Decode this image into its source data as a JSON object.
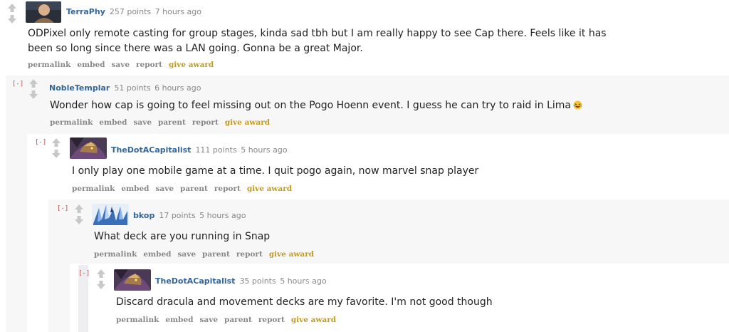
{
  "comments": [
    {
      "author": "TerraPhy",
      "points": "257 points",
      "time": "7 hours ago",
      "body": "ODPixel only remote casting for group stages, kinda sad tbh but I am really happy to see Cap there. Feels like it has been so long since there was a LAN going. Gonna be a great Major.",
      "buttons": [
        "permalink",
        "embed",
        "save",
        "report",
        "give award"
      ]
    },
    {
      "collapse": "[-]",
      "author": "NobleTemplar",
      "points": "51 points",
      "time": "6 hours ago",
      "body": "Wonder how cap is going to feel missing out on the Pogo Hoenn event. I guess he can try to raid in Lima",
      "emoji": "laughing-emoji",
      "buttons": [
        "permalink",
        "embed",
        "save",
        "parent",
        "report",
        "give award"
      ]
    },
    {
      "collapse": "[-]",
      "author": "TheDotACapitalist",
      "points": "111 points",
      "time": "5 hours ago",
      "body": "I only play one mobile game at a time. I quit pogo again, now marvel snap player",
      "buttons": [
        "permalink",
        "embed",
        "save",
        "parent",
        "report",
        "give award"
      ]
    },
    {
      "collapse": "[-]",
      "author": "bkop",
      "points": "17 points",
      "time": "5 hours ago",
      "body": "What deck are you running in Snap",
      "buttons": [
        "permalink",
        "embed",
        "save",
        "parent",
        "report",
        "give award"
      ]
    },
    {
      "collapse": "[-]",
      "author": "TheDotACapitalist",
      "points": "35 points",
      "time": "5 hours ago",
      "body": "Discard dracula and movement decks are my favorite. I'm not good though",
      "buttons": [
        "permalink",
        "embed",
        "save",
        "parent",
        "report",
        "give award"
      ]
    }
  ],
  "colors": {
    "author": "#336699",
    "award": "#c09b1c",
    "collapse": "#c04a4a",
    "meta": "#888888"
  },
  "icons": [
    "upvote-arrow-icon",
    "downvote-arrow-icon"
  ]
}
